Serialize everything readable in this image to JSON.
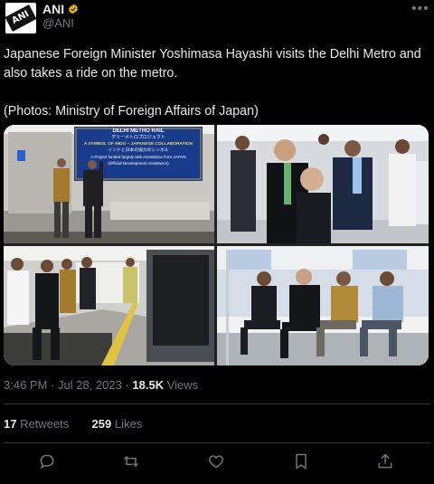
{
  "author": {
    "name": "ANI",
    "handle": "@ANI",
    "avatar_text": "ANI",
    "verified_color": "#e6b400"
  },
  "tweet": {
    "paragraph1": "Japanese Foreign Minister Yoshimasa Hayashi visits the Delhi Metro and also takes a ride on the metro.",
    "paragraph2": "(Photos: Ministry of Foreign Affairs of Japan)"
  },
  "photos": {
    "banner_title": "DELHI METRO RAIL",
    "banner_line1": "デリーメトロプロジェクト",
    "banner_line2": "A SYMBOL OF INDO – JAPANESE COLLABORATION",
    "banner_line3": "インドと日本の協力のシンボル",
    "banner_line4": "A Project funded largely with Assistance from JAPAN",
    "banner_line5": "(Official Development Assistance)"
  },
  "meta": {
    "time": "3:46 PM",
    "separator": " · ",
    "date": "Jul 28, 2023",
    "dot": " · ",
    "views_count": "18.5K",
    "views_label": " Views"
  },
  "stats": {
    "retweets_count": "17",
    "retweets_label": " Retweets",
    "likes_count": "259",
    "likes_label": " Likes"
  },
  "actions": {
    "reply_icon": "reply-icon",
    "retweet_icon": "retweet-icon",
    "like_icon": "heart-icon",
    "bookmark_icon": "bookmark-icon",
    "share_icon": "share-icon"
  },
  "colors": {
    "background": "#000000",
    "text": "#e7e9ea",
    "muted": "#71767b",
    "divider": "#2f3336"
  }
}
